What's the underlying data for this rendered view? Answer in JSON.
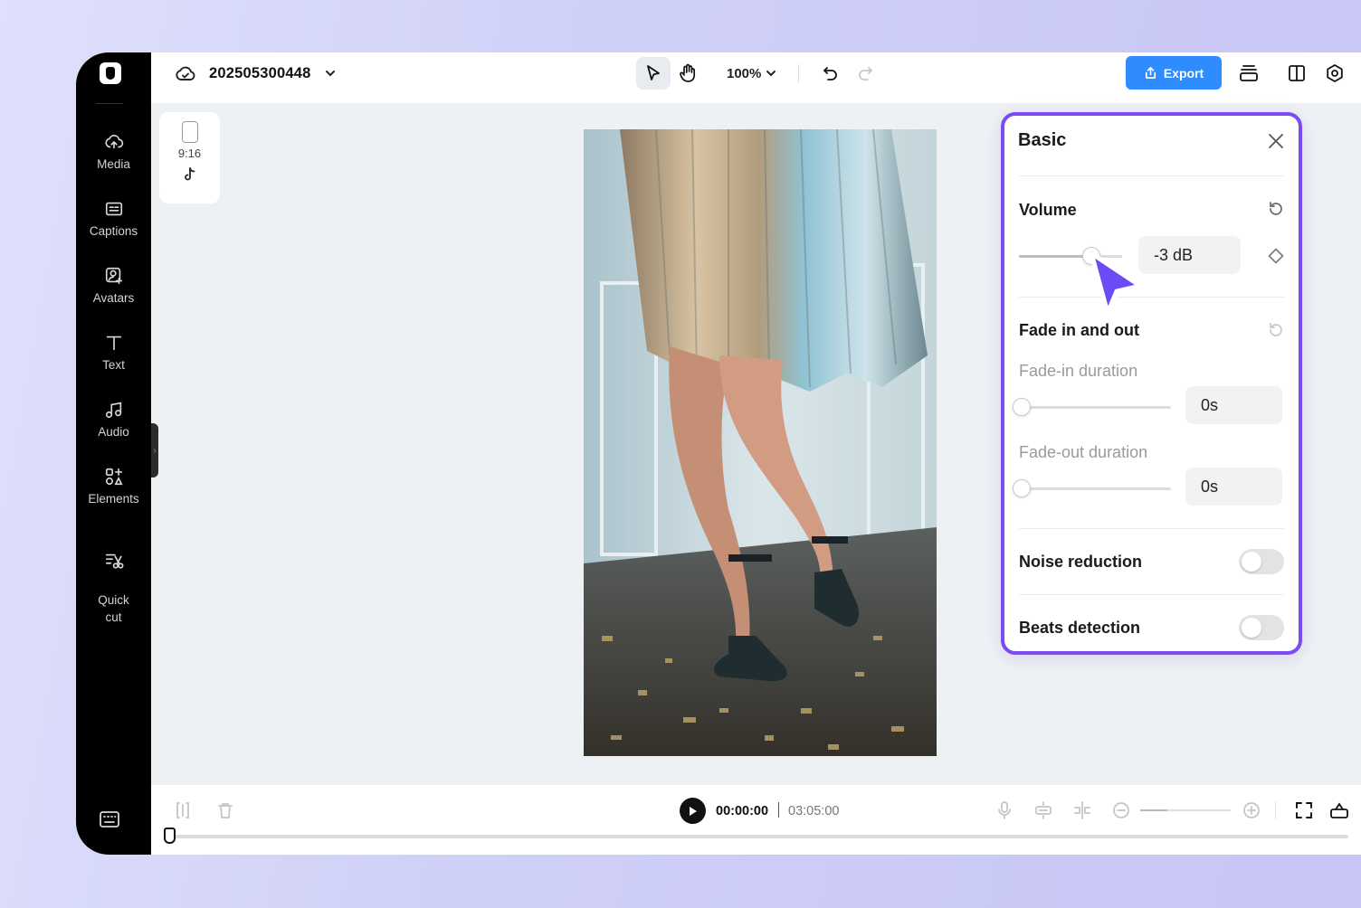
{
  "project": {
    "name": "202505300448"
  },
  "sidebar": {
    "items": [
      {
        "label": "Media",
        "icon": "cloud-upload-icon"
      },
      {
        "label": "Captions",
        "icon": "captions-icon"
      },
      {
        "label": "Avatars",
        "icon": "avatar-icon"
      },
      {
        "label": "Text",
        "icon": "text-icon"
      },
      {
        "label": "Audio",
        "icon": "music-note-icon"
      },
      {
        "label": "Elements",
        "icon": "elements-icon"
      },
      {
        "label": "Quick\ncut",
        "icon": "quick-cut-icon"
      }
    ]
  },
  "toolbar": {
    "zoom": "100%",
    "export_label": "Export"
  },
  "canvas": {
    "ratio_label": "9:16"
  },
  "panel": {
    "title": "Basic",
    "volume": {
      "label": "Volume",
      "value": "-3 dB",
      "level": 0.7
    },
    "fade": {
      "label": "Fade in and out",
      "fade_in_label": "Fade-in duration",
      "fade_in_value": "0s",
      "fade_out_label": "Fade-out duration",
      "fade_out_value": "0s"
    },
    "noise_reduction": {
      "label": "Noise reduction",
      "on": false
    },
    "beats_detection": {
      "label": "Beats detection",
      "on": false
    }
  },
  "playback": {
    "current_time": "00:00:00",
    "total_time": "03:05:00"
  },
  "colors": {
    "accent": "#7b4cf4",
    "export": "#2f8cff",
    "cursor": "#6b4bf5"
  }
}
